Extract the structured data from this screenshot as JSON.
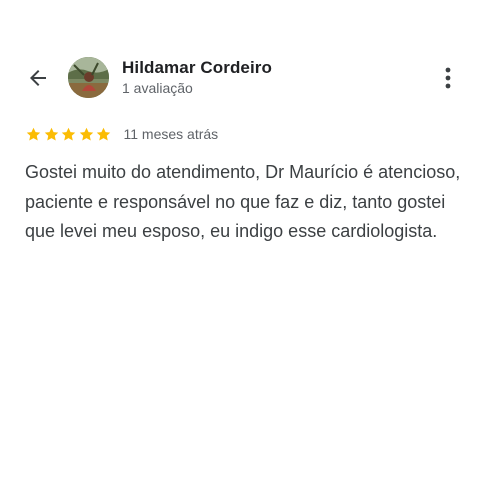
{
  "reviewer": {
    "name": "Hildamar Cordeiro",
    "reviews_count": "1 avaliação"
  },
  "review": {
    "rating": 5,
    "max_rating": 5,
    "time_ago": "11 meses atrás",
    "text": "Gostei muito do atendimento, Dr Maurício é atencioso, paciente e responsável no que faz e diz, tanto gostei que levei meu esposo, eu indigo esse cardiologista."
  },
  "icons": {
    "back": "arrow-back-icon",
    "more": "more-vert-icon",
    "star": "star-icon"
  },
  "colors": {
    "star": "#fbbc04",
    "name_text": "#202124",
    "secondary_text": "#5f6368",
    "body_text": "#3c4043"
  }
}
